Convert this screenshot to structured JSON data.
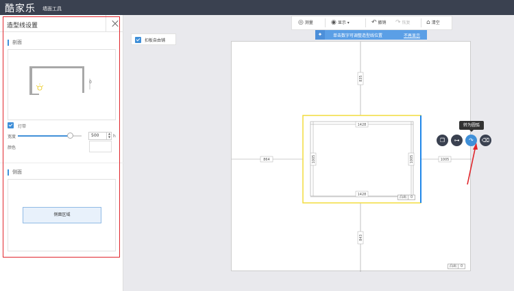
{
  "app": {
    "logo": "酷家乐",
    "subtitle": "墙面工具"
  },
  "panel": {
    "title": "造型线设置",
    "section_profile": "剖面",
    "preview_dim": "0",
    "light_strip_label": "灯带",
    "width_label": "宽度",
    "width_value": "500",
    "width_unit": "h",
    "width_level": 0.82,
    "color_label": "颜色",
    "section_side": "侧面",
    "side_area_button": "侧面区域"
  },
  "free_lay": {
    "label": "扣板自由铺"
  },
  "toolbar": {
    "measure": "测量",
    "show": "显示",
    "undo": "撤销",
    "redo": "恢复",
    "clear": "清空"
  },
  "hint": {
    "text": "单击数字可调整造型线位置",
    "link": "不再显示"
  },
  "canvas": {
    "dim_top": "835",
    "dim_left": "864",
    "dim_right": "1005",
    "dim_bottom": "843",
    "dim_inner_top": "1428",
    "dim_inner_bottom": "1428",
    "dim_inner_left": "1005",
    "dim_inner_right": "1005",
    "badge_inner_label": "凸出",
    "badge_inner_value": "0",
    "badge_outer_label": "凸出",
    "badge_outer_value": "0",
    "highlight_color": "#f2dc3c",
    "selected_edge_color": "#1e86e8"
  },
  "actions": {
    "tooltip": "转为圆弧",
    "icons": [
      "copy-icon",
      "split-icon",
      "arc-icon",
      "trash-icon"
    ]
  },
  "colors": {
    "accent": "#3f8fd8",
    "topbar": "#3a4150",
    "annotation_red": "#e0242a"
  }
}
